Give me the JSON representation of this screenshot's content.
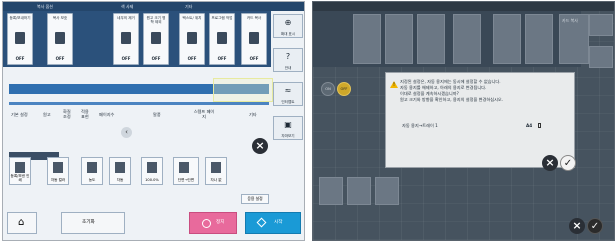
{
  "left_screen": {
    "header_labels": [
      "복사 옵션",
      "색 사제",
      "기타"
    ],
    "top_buttons": [
      {
        "label": "등록/보내하기",
        "state": "OFF"
      },
      {
        "label": "복사 보호",
        "state": "OFF"
      },
      {
        "label": "네우의 제거",
        "state": "OFF"
      },
      {
        "label": "원고 크기 명학 제외",
        "state": "OFF"
      },
      {
        "label": "택스트/ 위치",
        "state": "OFF"
      },
      {
        "label": "프로그램 작업",
        "state": "OFF"
      },
      {
        "label": "카드 복사",
        "state": "OFF"
      }
    ],
    "right_tools": [
      {
        "icon": "zoom-icon",
        "glyph": "⊕",
        "label": "확대 표시"
      },
      {
        "icon": "help-icon",
        "glyph": "?",
        "label": "안내"
      },
      {
        "icon": "fax-icon",
        "glyph": "≈",
        "label": "인터랩트"
      },
      {
        "icon": "printer-icon",
        "glyph": "▣",
        "label": "자마보기"
      }
    ],
    "tab_labels": [
      "기본 설정",
      "원고",
      "화질 조정",
      "적용 표현",
      "페이지수",
      "말풍",
      "스템프 페이지",
      "기타"
    ],
    "paper_buttons": [
      {
        "label": "등록/보낸 인쇄"
      },
      {
        "label": "자동 컬러"
      },
      {
        "label": "농도"
      },
      {
        "label": "자동"
      },
      {
        "label": "100.0%"
      },
      {
        "label": "단면→단면"
      },
      {
        "label": "자나 없"
      }
    ],
    "apply_label": "응용 설정",
    "footer": {
      "home_icon": "⌂",
      "reset_label": "초기화",
      "stop_label": "정지",
      "start_label": "시작"
    }
  },
  "right_screen": {
    "toggle_labels": [
      "ON",
      "OFF"
    ],
    "dialog": {
      "lines": [
        "지정된 설정은, 자동 용지에는 동시에 설정할 수 없습니다.",
        "자동 용지를 해제하고, 아래의 용지로 변경됩니다.",
        "이대로 설정을 계속하시겠습니까?",
        "원고 크기와 방향을 확인하고, 용지의 설정을 변경하십시오."
      ],
      "tray_label": "자동 용지→트레이 1",
      "paper_size": "A4"
    },
    "top_tab_label": "카드 복사"
  },
  "colors": {
    "header_blue": "#24466b",
    "accent_blue": "#2f6fb0",
    "stop_pink": "#e86a9c",
    "start_cyan": "#1a9ad6",
    "warning_yellow": "#f2b600"
  }
}
